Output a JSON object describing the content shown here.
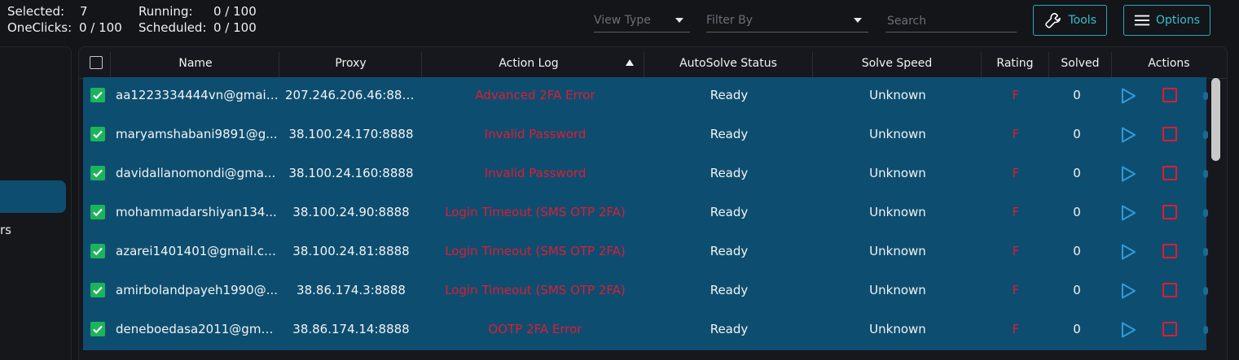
{
  "stats": {
    "selected_label": "Selected:",
    "selected_value": "7",
    "oneclicks_label": "OneClicks:",
    "oneclicks_value": "0 / 100",
    "running_label": "Running:",
    "running_value": "0 / 100",
    "scheduled_label": "Scheduled:",
    "scheduled_value": "0 / 100"
  },
  "toolbar": {
    "view_type_placeholder": "View Type",
    "filter_by_placeholder": "Filter By",
    "search_placeholder": "Search",
    "tools_label": "Tools",
    "options_label": "Options"
  },
  "sidebar": {
    "partial_item_text": "rs"
  },
  "table": {
    "columns": [
      "Name",
      "Proxy",
      "Action Log",
      "AutoSolve Status",
      "Solve Speed",
      "Rating",
      "Solved",
      "Actions"
    ],
    "sorted_column": "Action Log",
    "sort_direction": "ascending",
    "rows": [
      {
        "name": "aa1223334444vn@gmail...",
        "proxy": "207.246.206.46:8888",
        "log": "Advanced 2FA Error",
        "autosolve": "Ready",
        "speed": "Unknown",
        "rating": "F",
        "solved": "0",
        "checked": true
      },
      {
        "name": "maryamshabani9891@g...",
        "proxy": "38.100.24.170:8888",
        "log": "Invalid Password",
        "autosolve": "Ready",
        "speed": "Unknown",
        "rating": "F",
        "solved": "0",
        "checked": true
      },
      {
        "name": "davidallanomondi@gma...",
        "proxy": "38.100.24.160:8888",
        "log": "Invalid Password",
        "autosolve": "Ready",
        "speed": "Unknown",
        "rating": "F",
        "solved": "0",
        "checked": true
      },
      {
        "name": "mohammadarshiyan134...",
        "proxy": "38.100.24.90:8888",
        "log": "Login Timeout (SMS OTP 2FA)",
        "autosolve": "Ready",
        "speed": "Unknown",
        "rating": "F",
        "solved": "0",
        "checked": true
      },
      {
        "name": "azarei1401401@gmail.com",
        "proxy": "38.100.24.81:8888",
        "log": "Login Timeout (SMS OTP 2FA)",
        "autosolve": "Ready",
        "speed": "Unknown",
        "rating": "F",
        "solved": "0",
        "checked": true
      },
      {
        "name": "amirbolandpayeh1990@...",
        "proxy": "38.86.174.3:8888",
        "log": "Login Timeout (SMS OTP 2FA)",
        "autosolve": "Ready",
        "speed": "Unknown",
        "rating": "F",
        "solved": "0",
        "checked": true
      },
      {
        "name": "deneboedasa2011@gma...",
        "proxy": "38.86.174.14:8888",
        "log": "OOTP 2FA Error",
        "autosolve": "Ready",
        "speed": "Unknown",
        "rating": "F",
        "solved": "0",
        "checked": true
      }
    ]
  },
  "icons": {
    "tools": "wrench-icon",
    "options": "hamburger-menu-icon",
    "row_check": "checkbox-checked-icon",
    "start": "play-icon",
    "stop": "stop-icon"
  },
  "colors": {
    "accent": "#2aa9b8",
    "row_bg": "#0d4e70",
    "error_text": "#e01b32",
    "check_green": "#1cb45a",
    "play_blue": "#2f9bdc"
  }
}
